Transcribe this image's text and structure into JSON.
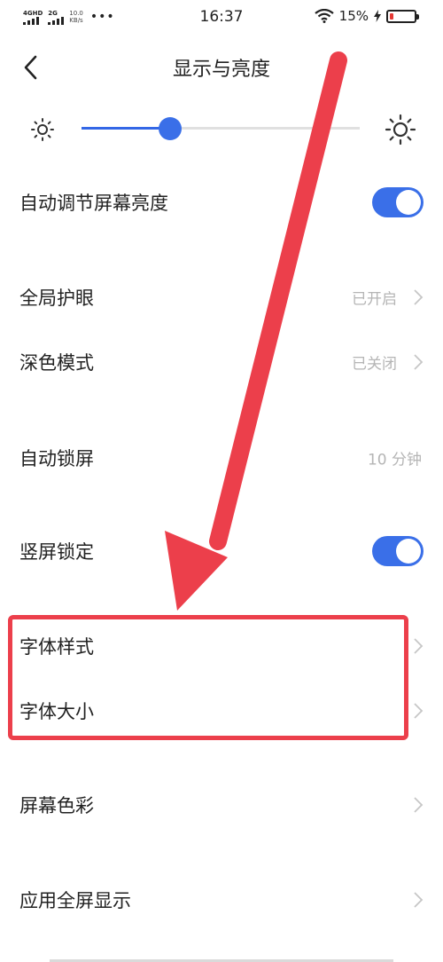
{
  "status_bar": {
    "sim1_label": "4GHD",
    "sim2_label": "2G",
    "speed_value": "10.0",
    "speed_unit": "KB/s",
    "more": "•••",
    "time": "16:37",
    "battery": "15%",
    "icons": [
      "signal-icon",
      "wifi-icon",
      "charging-icon",
      "battery-icon"
    ]
  },
  "header": {
    "title": "显示与亮度",
    "back_icon": "chevron-left-icon"
  },
  "brightness": {
    "level": 0.32,
    "accent": "#3a6fe8"
  },
  "settings": [
    {
      "id": "auto-brightness",
      "label": "自动调节屏幕亮度",
      "type": "toggle",
      "on": true
    },
    {
      "id": "eye-care",
      "label": "全局护眼",
      "value": "已开启",
      "type": "link"
    },
    {
      "id": "dark-mode",
      "label": "深色模式",
      "value": "已关闭",
      "type": "link"
    },
    {
      "id": "auto-lock",
      "label": "自动锁屏",
      "value": "10 分钟",
      "type": "value"
    },
    {
      "id": "portrait-lock",
      "label": "竖屏锁定",
      "type": "toggle",
      "on": true
    },
    {
      "id": "font-style",
      "label": "字体样式",
      "type": "link"
    },
    {
      "id": "font-size",
      "label": "字体大小",
      "type": "link"
    },
    {
      "id": "screen-color",
      "label": "屏幕色彩",
      "type": "link"
    },
    {
      "id": "fullscreen-apps",
      "label": "应用全屏显示",
      "type": "link"
    }
  ],
  "annotation": {
    "arrow_color": "#ec3f4b",
    "highlight_color": "#ec3f4b"
  }
}
